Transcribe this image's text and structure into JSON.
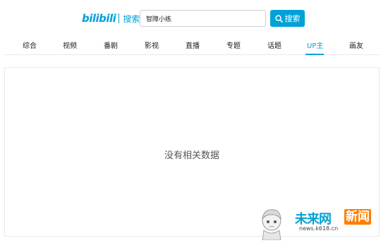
{
  "header": {
    "logo_mark": "bilibili",
    "logo_text": "搜索",
    "search_value": "智障小练",
    "search_button_label": "搜索"
  },
  "tabs": [
    {
      "label": "综合",
      "active": false
    },
    {
      "label": "视频",
      "active": false
    },
    {
      "label": "番剧",
      "active": false
    },
    {
      "label": "影视",
      "active": false
    },
    {
      "label": "直播",
      "active": false
    },
    {
      "label": "专题",
      "active": false
    },
    {
      "label": "话题",
      "active": false
    },
    {
      "label": "UP主",
      "active": true
    },
    {
      "label": "画友",
      "active": false
    }
  ],
  "main": {
    "empty_message": "没有相关数据"
  },
  "watermark": {
    "title": "未来网",
    "badge": "新闻",
    "url": "news.k618.cn"
  },
  "colors": {
    "accent": "#00a1d6",
    "border": "#e5e9ef",
    "watermark_badge": "#ff7e00"
  },
  "icons": {
    "search_button_icon": "search-icon"
  }
}
